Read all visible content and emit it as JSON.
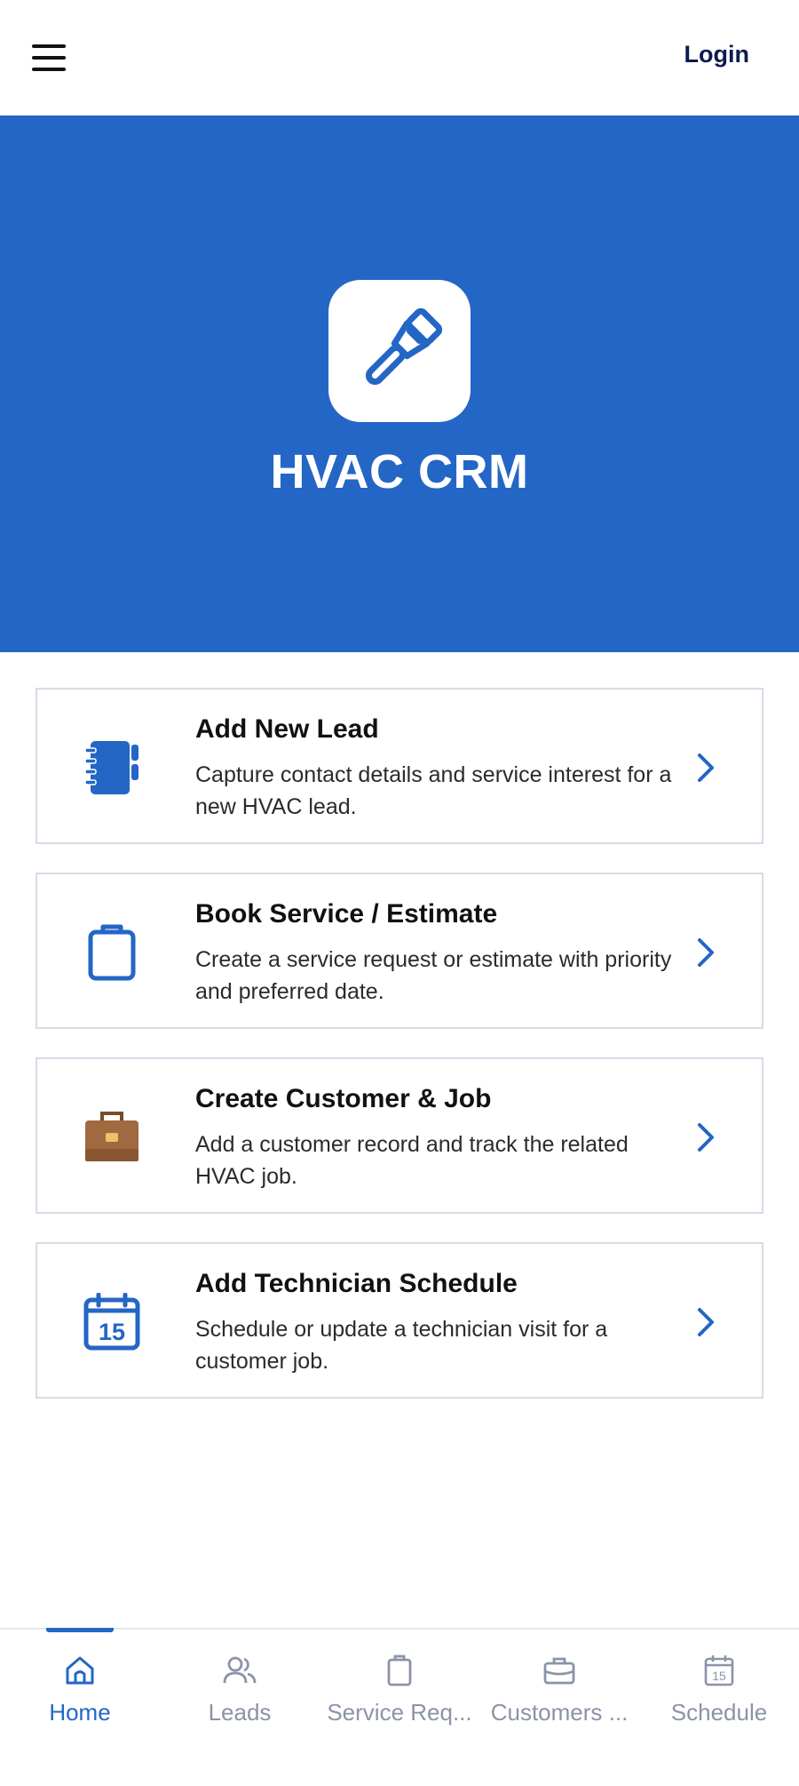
{
  "header": {
    "login_label": "Login",
    "menu_icon": "hamburger-menu-icon"
  },
  "hero": {
    "app_icon": "paint-brush-icon",
    "title": "HVAC CRM",
    "background": "#2466c5"
  },
  "cards": [
    {
      "icon": "notebook-icon",
      "title": "Add New Lead",
      "description": "Capture contact details and service interest for a new HVAC lead."
    },
    {
      "icon": "clipboard-icon",
      "title": "Book Service / Estimate",
      "description": "Create a service request or estimate with priority and preferred date."
    },
    {
      "icon": "briefcase-icon",
      "title": "Create Customer & Job",
      "description": "Add a customer record and track the related HVAC job."
    },
    {
      "icon": "calendar-icon",
      "title": "Add Technician Schedule",
      "description": "Schedule or update a technician visit for a customer job."
    }
  ],
  "calendar_day": "15",
  "bottom_nav": [
    {
      "label": "Home",
      "icon": "home-icon",
      "active": true
    },
    {
      "label": "Leads",
      "icon": "people-icon",
      "active": false
    },
    {
      "label": "Service Req...",
      "icon": "clipboard-icon",
      "active": false
    },
    {
      "label": "Customers ...",
      "icon": "briefcase-icon",
      "active": false
    },
    {
      "label": "Schedule",
      "icon": "calendar-icon",
      "active": false
    }
  ],
  "colors": {
    "accent": "#2466c5",
    "inactive": "#8b93a7",
    "briefcase": "#a0693f"
  }
}
